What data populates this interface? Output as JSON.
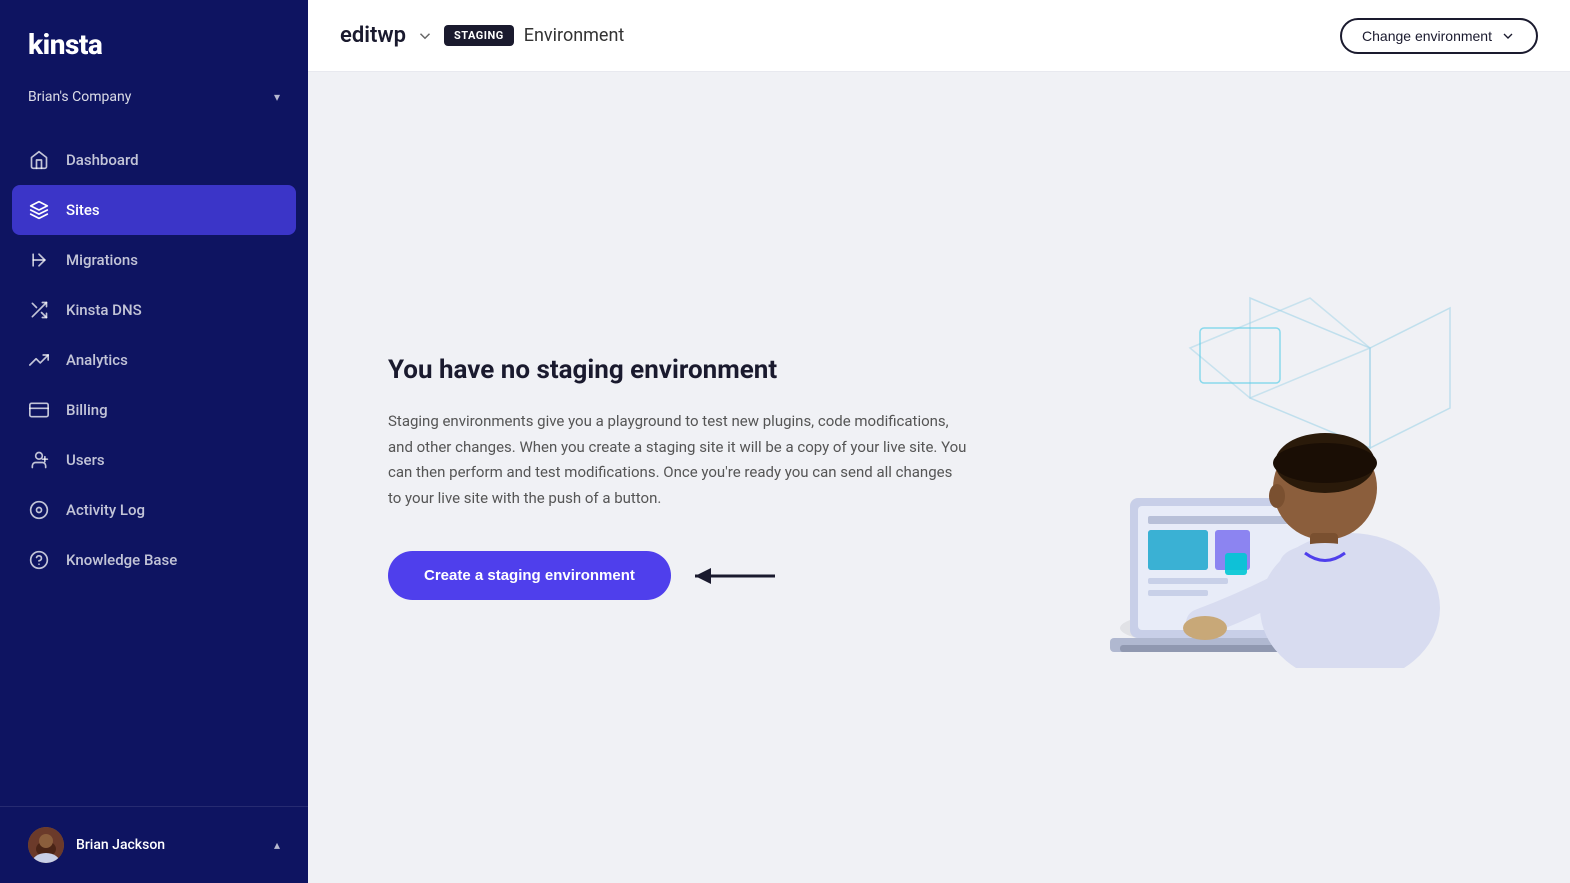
{
  "sidebar": {
    "logo": "kinsta",
    "company": {
      "name": "Brian's Company",
      "chevron": "▾"
    },
    "nav_items": [
      {
        "id": "dashboard",
        "label": "Dashboard",
        "icon": "home",
        "active": false
      },
      {
        "id": "sites",
        "label": "Sites",
        "icon": "layers",
        "active": true
      },
      {
        "id": "migrations",
        "label": "Migrations",
        "icon": "arrow-right",
        "active": false
      },
      {
        "id": "kinsta-dns",
        "label": "Kinsta DNS",
        "icon": "shuffle",
        "active": false
      },
      {
        "id": "analytics",
        "label": "Analytics",
        "icon": "trending-up",
        "active": false
      },
      {
        "id": "billing",
        "label": "Billing",
        "icon": "credit-card",
        "active": false
      },
      {
        "id": "users",
        "label": "Users",
        "icon": "user-plus",
        "active": false
      },
      {
        "id": "activity-log",
        "label": "Activity Log",
        "icon": "eye",
        "active": false
      },
      {
        "id": "knowledge-base",
        "label": "Knowledge Base",
        "icon": "help-circle",
        "active": false
      }
    ],
    "user": {
      "name": "Brian Jackson",
      "chevron": "▴"
    }
  },
  "header": {
    "site_name": "editwp",
    "staging_badge": "STAGING",
    "environment_label": "Environment",
    "change_env_button": "Change environment"
  },
  "main": {
    "title": "You have no staging environment",
    "description": "Staging environments give you a playground to test new plugins, code modifications, and other changes. When you create a staging site it will be a copy of your live site. You can then perform and test modifications. Once you're ready you can send all changes to your live site with the push of a button.",
    "cta_button": "Create a staging environment"
  },
  "colors": {
    "sidebar_bg": "#0e1461",
    "active_nav": "#3b35c8",
    "cta_button": "#4f3fec",
    "arrow_color": "#1a1a2e"
  }
}
